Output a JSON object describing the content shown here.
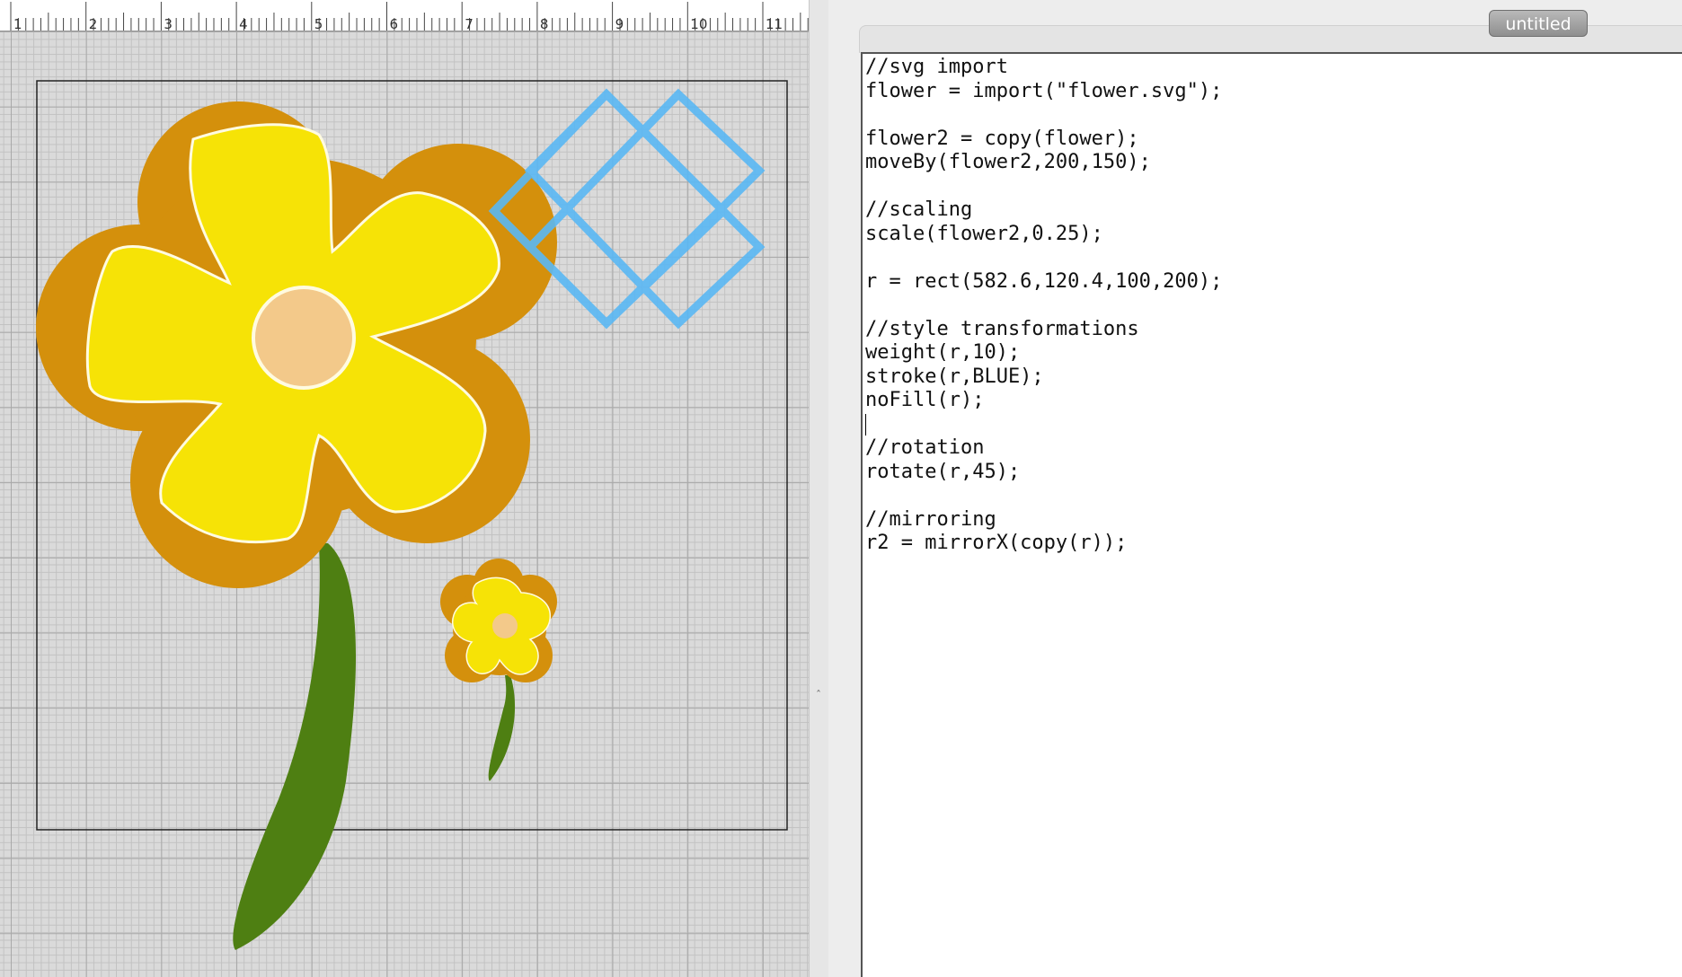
{
  "ruler": {
    "labels": [
      "1",
      "2",
      "3",
      "4",
      "5",
      "6",
      "7",
      "8",
      "9",
      "10",
      "11"
    ]
  },
  "document": {
    "tab_title": "untitled"
  },
  "code": {
    "lines": [
      "//svg import",
      "flower = import(\"flower.svg\");",
      "",
      "flower2 = copy(flower);",
      "moveBy(flower2,200,150);",
      "",
      "//scaling",
      "scale(flower2,0.25);",
      "",
      "r = rect(582.6,120.4,100,200);",
      "",
      "//style transformations",
      "weight(r,10);",
      "stroke(r,BLUE);",
      "noFill(r);",
      "",
      "//rotation",
      "rotate(r,45);",
      "",
      "//mirroring",
      "r2 = mirrorX(copy(r));"
    ]
  },
  "colors": {
    "flower_outer": "#d4900c",
    "flower_petal": "#f6e306",
    "flower_center": "#f3c98a",
    "stem": "#4e7f12",
    "rect_stroke": "#5ab8f4",
    "canvas_grid": "#c2c2c2"
  }
}
